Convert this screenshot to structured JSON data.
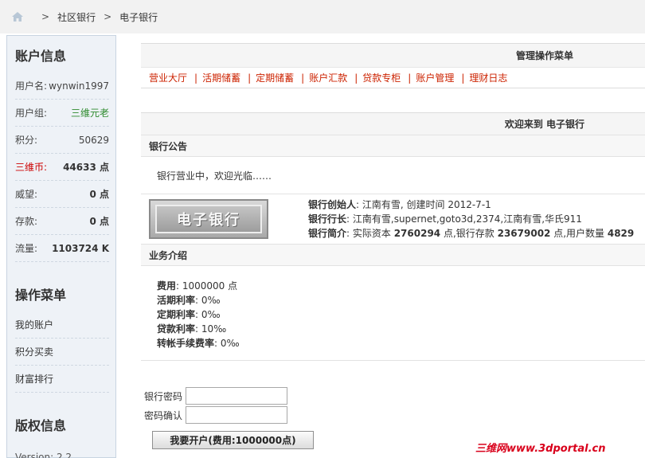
{
  "breadcrumb": {
    "items": [
      "社区银行",
      "电子银行"
    ],
    "sep": ">"
  },
  "sidebar": {
    "account_title": "账户信息",
    "rows": [
      {
        "k": "用户名:",
        "v": "wynwin1997"
      },
      {
        "k": "用户组:",
        "v": "三维元老"
      },
      {
        "k": "积分:",
        "v": "50629"
      },
      {
        "k": "三维币:",
        "v": "44633 点"
      },
      {
        "k": "威望:",
        "v": "0 点"
      },
      {
        "k": "存款:",
        "v": "0 点"
      },
      {
        "k": "流量:",
        "v": "1103724 K"
      }
    ],
    "menu_title": "操作菜单",
    "menu": [
      "我的账户",
      "积分买卖",
      "财富排行"
    ],
    "copyright_title": "版权信息",
    "version": "Version: 2.2"
  },
  "main": {
    "menu_head": "管理操作菜单",
    "tabs": [
      "营业大厅",
      "活期储蓄",
      "定期储蓄",
      "账户汇款",
      "贷款专柜",
      "账户管理",
      "理财日志"
    ],
    "welcome": "欢迎来到 电子银行",
    "notice_title": "银行公告",
    "notice_text": "银行营业中，欢迎光临……",
    "logo_text": "电子银行",
    "founder_label": "银行创始人",
    "founder_value": ": 江南有雪, 创建时间 2012-7-1",
    "president_label": "银行行长",
    "president_value": ": 江南有雪,supernet,goto3d,2374,江南有雪,华氏911",
    "intro_label": "银行简介",
    "intro_a": ": 实际资本 ",
    "capital": "2760294",
    "intro_b": " 点,银行存款 ",
    "deposit": "23679002",
    "intro_c": " 点,用户数量 ",
    "users": "4829",
    "biz_title": "业务介绍",
    "biz": [
      {
        "k": "费用",
        "v": ": 1000000 点"
      },
      {
        "k": "活期利率",
        "v": ": 0‰"
      },
      {
        "k": "定期利率",
        "v": ": 0‰"
      },
      {
        "k": "贷款利率",
        "v": ": 10‰"
      },
      {
        "k": "转帐手续费率",
        "v": ": 0‰"
      }
    ]
  },
  "form": {
    "password_label": "银行密码",
    "confirm_label": "密码确认",
    "submit": "我要开户(费用:1000000点)"
  },
  "watermark": "三维网www.3dportal.cn"
}
